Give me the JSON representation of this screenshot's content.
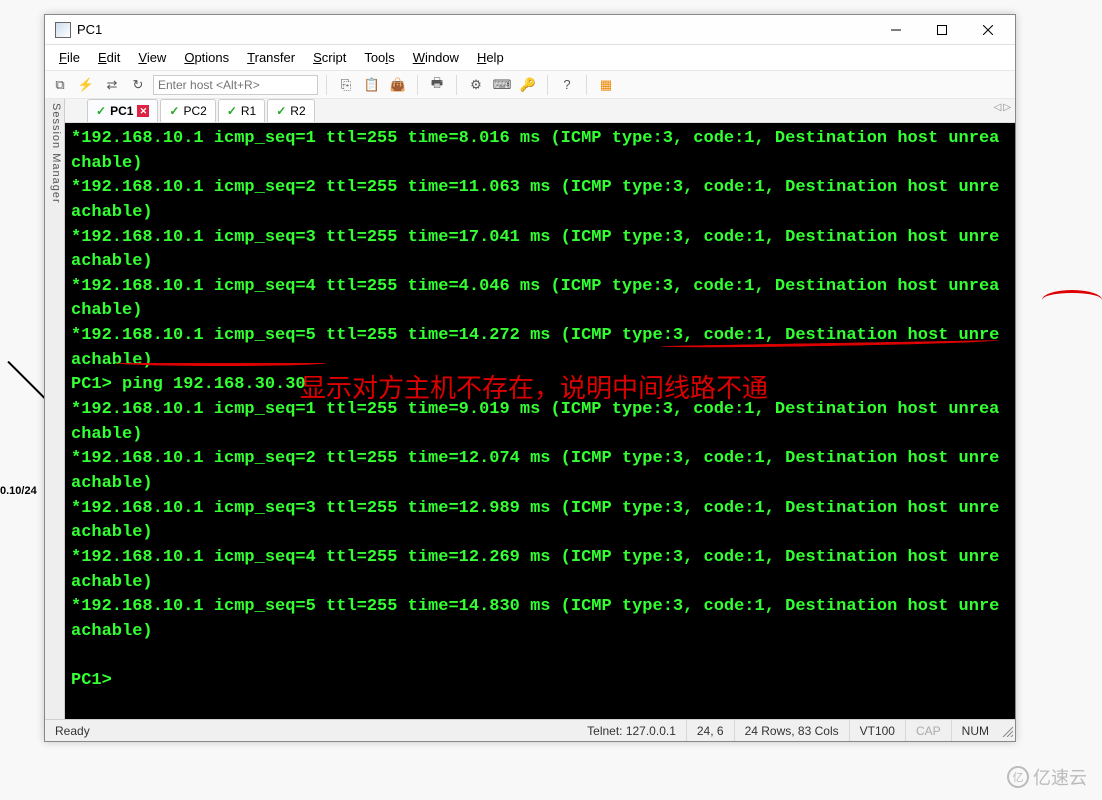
{
  "window": {
    "title": "PC1"
  },
  "menu": {
    "file": "File",
    "edit": "Edit",
    "view": "View",
    "options": "Options",
    "transfer": "Transfer",
    "script": "Script",
    "tools": "Tools",
    "window": "Window",
    "help": "Help"
  },
  "toolbar": {
    "host_placeholder": "Enter host <Alt+R>"
  },
  "session_mgr_label": "Session Manager",
  "tabs": [
    {
      "label": "PC1",
      "active": true,
      "closable": true
    },
    {
      "label": "PC2",
      "active": false,
      "closable": false
    },
    {
      "label": "R1",
      "active": false,
      "closable": false
    },
    {
      "label": "R2",
      "active": false,
      "closable": false
    }
  ],
  "terminal_lines": [
    "*192.168.10.1 icmp_seq=1 ttl=255 time=8.016 ms (ICMP type:3, code:1, Destination host unreachable)",
    "*192.168.10.1 icmp_seq=2 ttl=255 time=11.063 ms (ICMP type:3, code:1, Destination host unreachable)",
    "*192.168.10.1 icmp_seq=3 ttl=255 time=17.041 ms (ICMP type:3, code:1, Destination host unreachable)",
    "*192.168.10.1 icmp_seq=4 ttl=255 time=4.046 ms (ICMP type:3, code:1, Destination host unreachable)",
    "*192.168.10.1 icmp_seq=5 ttl=255 time=14.272 ms (ICMP type:3, code:1, Destination host unreachable)",
    "PC1> ping 192.168.30.30",
    "*192.168.10.1 icmp_seq=1 ttl=255 time=9.019 ms (ICMP type:3, code:1, Destination host unreachable)",
    "*192.168.10.1 icmp_seq=2 ttl=255 time=12.074 ms (ICMP type:3, code:1, Destination host unreachable)",
    "*192.168.10.1 icmp_seq=3 ttl=255 time=12.989 ms (ICMP type:3, code:1, Destination host unreachable)",
    "*192.168.10.1 icmp_seq=4 ttl=255 time=12.269 ms (ICMP type:3, code:1, Destination host unreachable)",
    "*192.168.10.1 icmp_seq=5 ttl=255 time=14.830 ms (ICMP type:3, code:1, Destination host unreachable)",
    "",
    "PC1> "
  ],
  "annotation_text": "显示对方主机不存在，说明中间线路不通",
  "status": {
    "ready": "Ready",
    "conn": "Telnet: 127.0.0.1",
    "cursor": "24,  6",
    "size": "24 Rows, 83 Cols",
    "term": "VT100",
    "cap": "CAP",
    "num": "NUM"
  },
  "bg_ip": "0.10/24",
  "watermark": "亿速云"
}
